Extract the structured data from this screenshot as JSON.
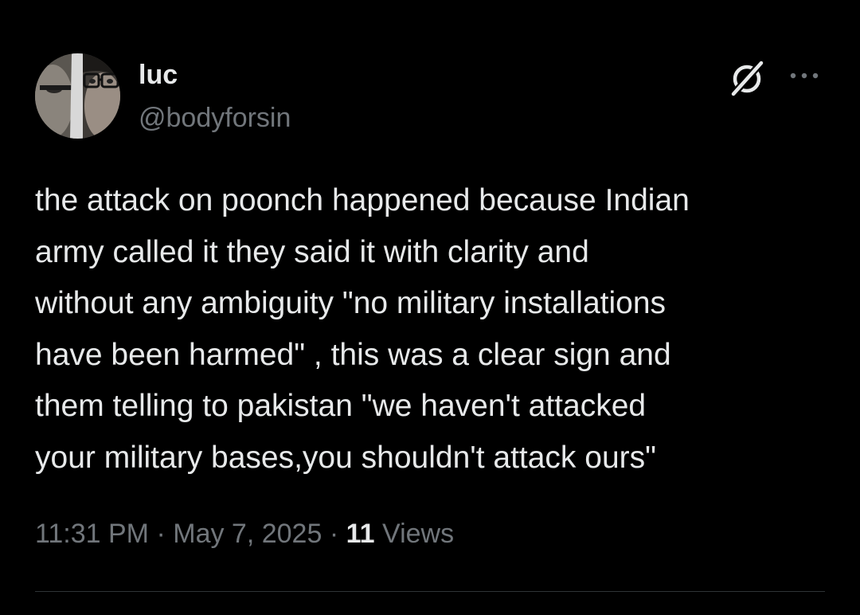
{
  "author": {
    "display_name": "luc",
    "handle": "@bodyforsin"
  },
  "icons": {
    "grok": "grok-icon",
    "more": "more-icon"
  },
  "tweet": {
    "text": "the attack on poonch happened because Indian\narmy called it they said it with clarity and\nwithout any ambiguity \"no military installations\nhave been harmed\" , this was a clear sign and\nthem telling to pakistan \"we haven't attacked\nyour military bases,you shouldn't attack ours\"",
    "time": "11:31 PM",
    "date": "May 7, 2025",
    "separator": "·",
    "views_count": "11",
    "views_label": "Views"
  },
  "colors": {
    "background": "#000000",
    "text_primary": "#e7e9ea",
    "text_secondary": "#71767b",
    "divider": "#2f3336"
  }
}
